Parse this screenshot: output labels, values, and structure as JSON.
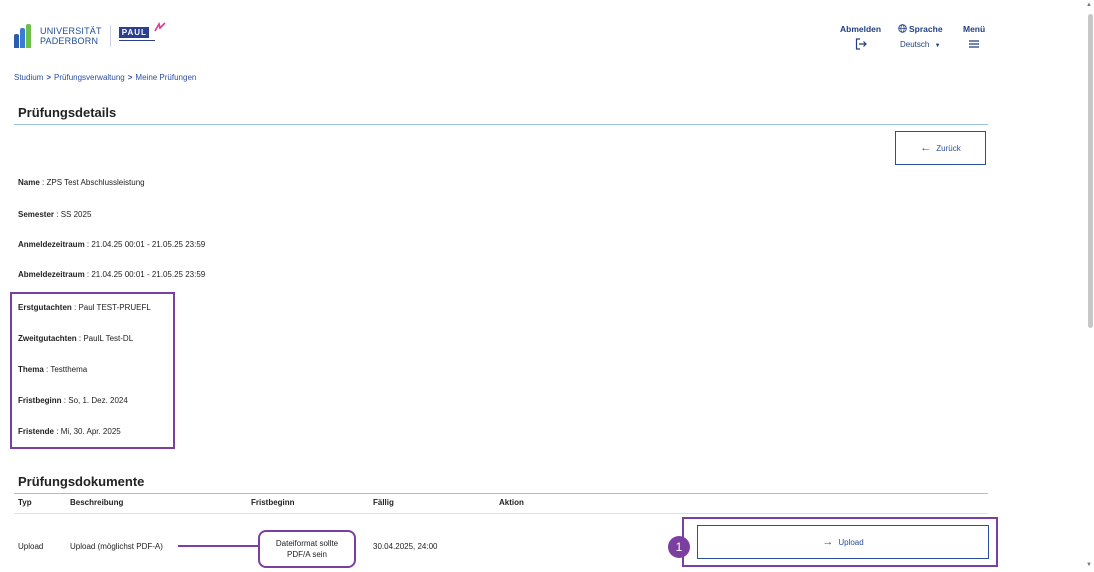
{
  "header": {
    "logo_line1": "UNIVERSITÄT",
    "logo_line2": "PADERBORN",
    "paul_label": "PAUL",
    "logout_label": "Abmelden",
    "language_label": "Sprache",
    "language_value": "Deutsch",
    "menu_label": "Menü"
  },
  "breadcrumb": [
    "Studium",
    "Prüfungsverwaltung",
    "Meine Prüfungen"
  ],
  "details": {
    "title": "Prüfungsdetails",
    "back_label": "Zurück",
    "fields": [
      {
        "label": "Name",
        "value": "ZPS Test Abschlussleistung"
      },
      {
        "label": "Semester",
        "value": "SS 2025"
      },
      {
        "label": "Anmeldezeitraum",
        "value": "21.04.25 00:01 - 21.05.25 23:59"
      },
      {
        "label": "Abmeldezeitraum",
        "value": "21.04.25 00:01 - 21.05.25 23:59"
      },
      {
        "label": "Erstgutachten",
        "value": "Paul TEST-PRUEFL"
      },
      {
        "label": "Zweitgutachten",
        "value": "PaulL Test-DL"
      },
      {
        "label": "Thema",
        "value": "Testthema"
      },
      {
        "label": "Fristbeginn",
        "value": "So, 1. Dez. 2024"
      },
      {
        "label": "Fristende",
        "value": "Mi, 30. Apr. 2025"
      }
    ]
  },
  "documents": {
    "title": "Prüfungsdokumente",
    "columns": [
      "Typ",
      "Beschreibung",
      "Fristbeginn",
      "Fällig",
      "Aktion"
    ],
    "rows": [
      {
        "typ": "Upload",
        "beschreibung": "Upload (möglichst PDF-A)",
        "fristbeginn": "",
        "faellig": "30.04.2025, 24:00",
        "aktion": "Upload"
      }
    ]
  },
  "annotations": {
    "callout_line1": "Dateiformat sollte",
    "callout_line2": "PDF/A sein",
    "step_number": "1",
    "accent_color": "#7b3fa0"
  }
}
